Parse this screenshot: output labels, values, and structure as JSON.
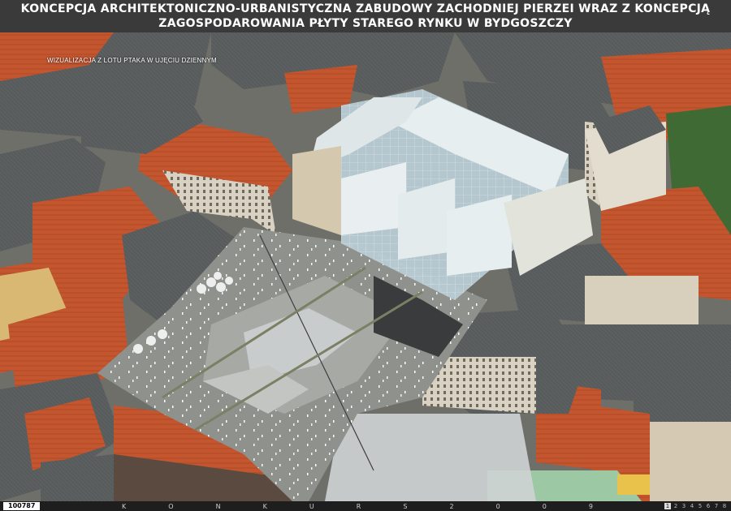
{
  "header": {
    "line1": "KONCEPCJA ARCHITEKTONICZNO-URBANISTYCZNA ZABUDOWY ZACHODNIEJ PIERZEI WRAZ Z KONCEPCJĄ",
    "line2": "ZAGOSPODAROWANIA PŁYTY STAREGO RYNKU W BYDGOSZCZY"
  },
  "subtitle": "WIZUALIZACJA Z LOTU PTAKA W UJĘCIU DZIENNYM",
  "footer": {
    "code": "100787",
    "konkurs_letters": [
      "K",
      "O",
      "N",
      "K",
      "U",
      "R",
      "S",
      "2",
      "0",
      "0",
      "9"
    ],
    "pages": [
      "1",
      "2",
      "3",
      "4",
      "5",
      "6",
      "7",
      "8"
    ],
    "current_page": "1"
  },
  "colors": {
    "roof_red": "#c1522c",
    "roof_gray": "#5d6061",
    "plaza": "#9a9b97",
    "glass": "#cfe0e8",
    "header_bg": "#3a3a3a"
  }
}
